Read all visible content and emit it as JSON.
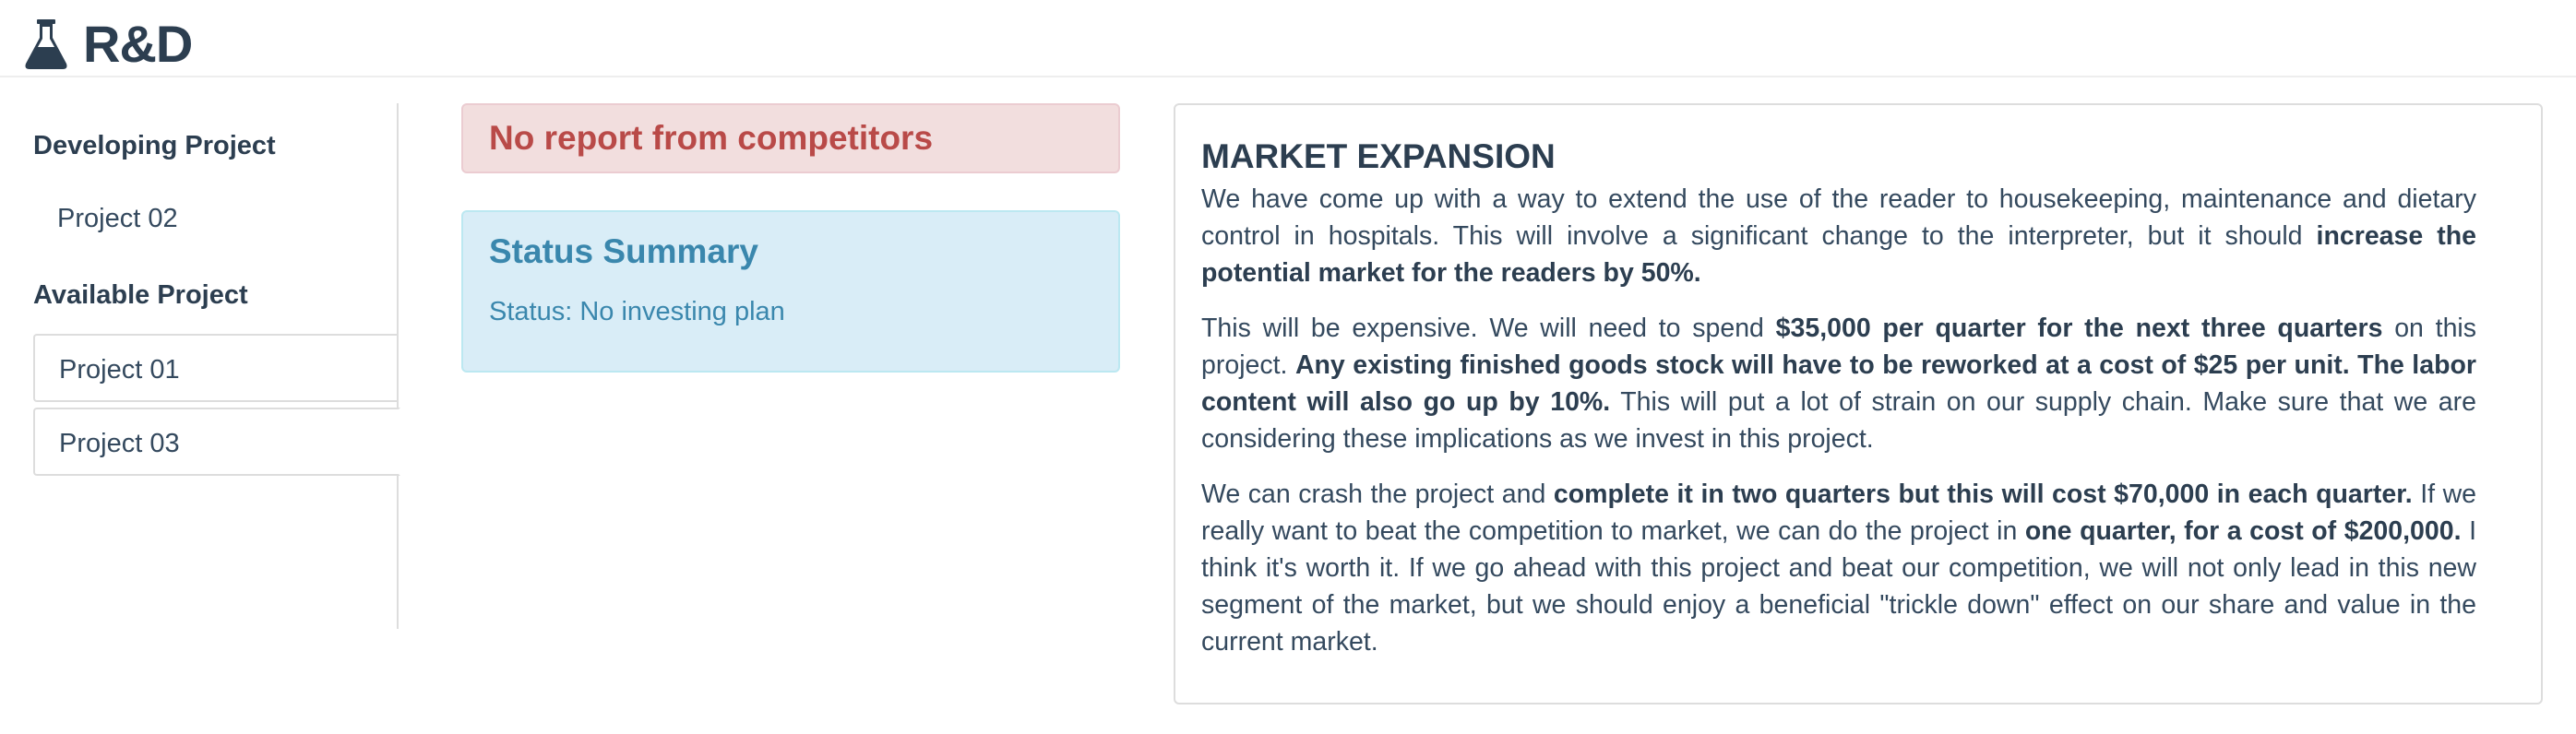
{
  "header": {
    "icon": "flask-icon",
    "title": "R&D"
  },
  "sidebar": {
    "developing_heading": "Developing Project",
    "developing_items": [
      "Project 02"
    ],
    "available_heading": "Available Project",
    "available_items": [
      "Project 01",
      "Project 03"
    ],
    "active_item": "Project 03"
  },
  "alerts": {
    "competitors": "No report from competitors",
    "status_title": "Status Summary",
    "status_text": "Status: No investing plan"
  },
  "market": {
    "title": "MARKET EXPANSION",
    "p1": [
      {
        "t": "We have come up with a way to extend the use of the reader to housekeeping, maintenance and dietary control in hospitals. This will involve a significant change to the interpreter, but it should "
      },
      {
        "b": "increase the potential market for the readers by 50%."
      }
    ],
    "p2": [
      {
        "t": "This will be expensive. We will need to spend "
      },
      {
        "b": "$35,000 per quarter for the next three quarters"
      },
      {
        "t": " on this project. "
      },
      {
        "b": "Any existing finished goods stock will have to be reworked at a cost of $25 per unit. The labor content will also go up by 10%."
      },
      {
        "t": " This will put a lot of strain on our supply chain. Make sure that we are considering these implications as we invest in this project."
      }
    ],
    "p3": [
      {
        "t": "We can crash the project and "
      },
      {
        "b": "complete it in two quarters but this will cost $70,000 in each quarter."
      },
      {
        "t": " If we really want to beat the competition to market, we can do the project in "
      },
      {
        "b": "one quarter, for a cost of $200,000."
      },
      {
        "t": " I think it's worth it. If we go ahead with this project and beat our competition, we will not only lead in this new segment of the market, but we should enjoy a beneficial \"trickle down\" effect on our share and value in the current market."
      }
    ]
  },
  "colors": {
    "danger_bg": "#f2dede",
    "danger_text": "#b94a48",
    "info_bg": "#d9edf7",
    "info_text": "#3a87ad",
    "text": "#34495e"
  }
}
